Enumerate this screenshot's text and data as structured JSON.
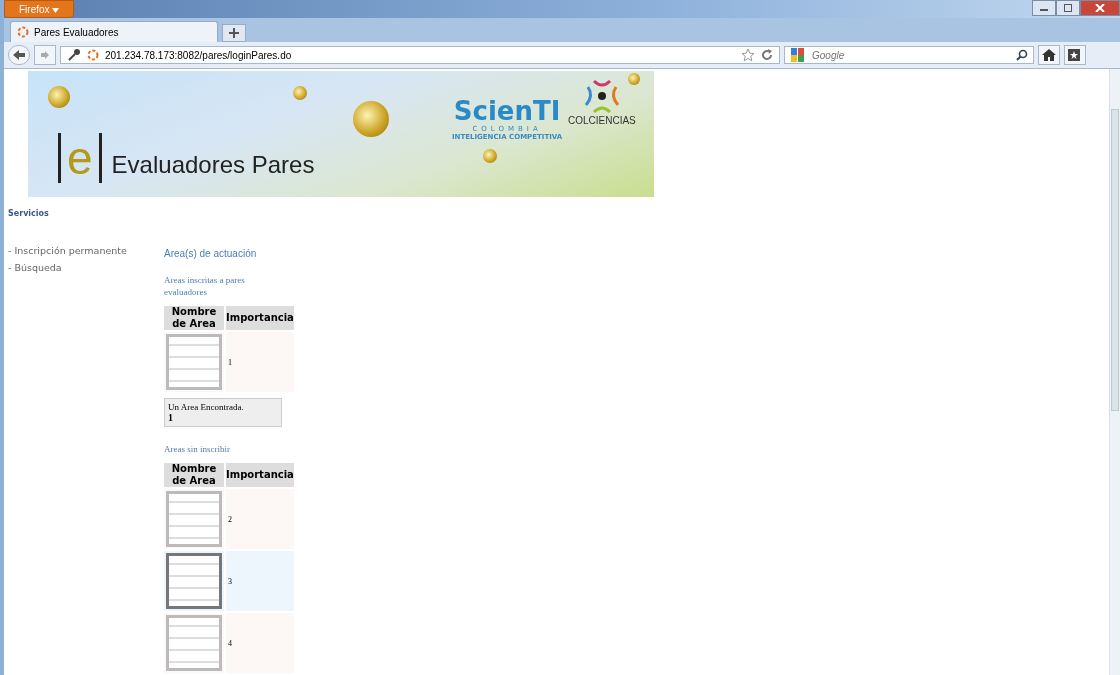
{
  "browser": {
    "menu_button": "Firefox",
    "tab_title": "Pares Evaluadores",
    "url": "201.234.78.173:8082/pares/loginPares.do",
    "search_placeholder": "Google"
  },
  "banner": {
    "logo_letter": "e",
    "title": "Evaluadores Pares",
    "brand": "ScienTI",
    "brand_country": "COLOMBIA",
    "brand_tagline": "INTELIGENCIA COMPETITIVA",
    "org": "COLCIENCIAS"
  },
  "sidebar": {
    "heading": "Servicios",
    "items": [
      "- Inscripción permanente",
      "- Búsqueda"
    ]
  },
  "main": {
    "heading": "Area(s) de actuación",
    "sections": [
      {
        "title": "Areas inscritas a pares evaluadores",
        "columns": [
          "Nombre de Area",
          "Importancia"
        ],
        "rows": [
          {
            "importance": "1",
            "selected": false
          }
        ],
        "footer": {
          "text": "Un Area Encontrada.",
          "count": "1"
        }
      },
      {
        "title": "Areas sin inscribir",
        "columns": [
          "Nombre de Area",
          "Importancia"
        ],
        "rows": [
          {
            "importance": "2",
            "selected": false
          },
          {
            "importance": "3",
            "selected": true
          },
          {
            "importance": "4",
            "selected": false
          }
        ]
      }
    ]
  }
}
